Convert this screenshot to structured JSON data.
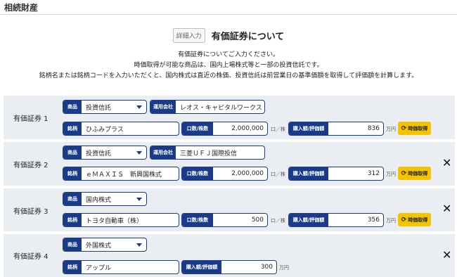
{
  "page_title": "相続財産",
  "heading": {
    "tag": "詳細入力",
    "text": "有価証券について"
  },
  "description": [
    "有価証券についてご入力ください。",
    "時価取得が可能な商品は、国内上場株式等と一部の投資信託です。",
    "銘柄名または銘柄コードを入力いただくと、国内株式は直近の株価、投資信託は前営業日の基準価額を取得して評価額を計算します。"
  ],
  "labels": {
    "product": "商品",
    "company": "運用会社",
    "brand": "銘柄",
    "quantity": "口数/株数",
    "purchase": "購入額/評価額",
    "quantity_unit": "口／株",
    "yen_unit": "万円",
    "price_button": "時価取得"
  },
  "icons": {
    "refresh": "refresh-icon",
    "close": "close-icon",
    "caret": "chevron-down-icon"
  },
  "colors": {
    "navy": "#1a3a8a",
    "yellow": "#f5c400",
    "card_bg": "#eaeef3"
  },
  "securities": [
    {
      "label": "有価証券 1",
      "product": "投資信託",
      "company": "レオス・キャピタルワークス",
      "brand": "ひふみプラス",
      "quantity": "2,000,000",
      "amount": "836"
    },
    {
      "label": "有価証券 2",
      "product": "投資信託",
      "company": "三菱ＵＦＪ国際投信",
      "brand": "ｅＭＡＸＩＳ　新興国株式",
      "quantity": "2,000,000",
      "amount": "312"
    },
    {
      "label": "有価証券 3",
      "product": "国内株式",
      "brand": "トヨタ自動車（株）",
      "quantity": "500",
      "amount": "356"
    },
    {
      "label": "有価証券 4",
      "product": "外国株式",
      "brand": "アップル",
      "amount": "300"
    }
  ]
}
